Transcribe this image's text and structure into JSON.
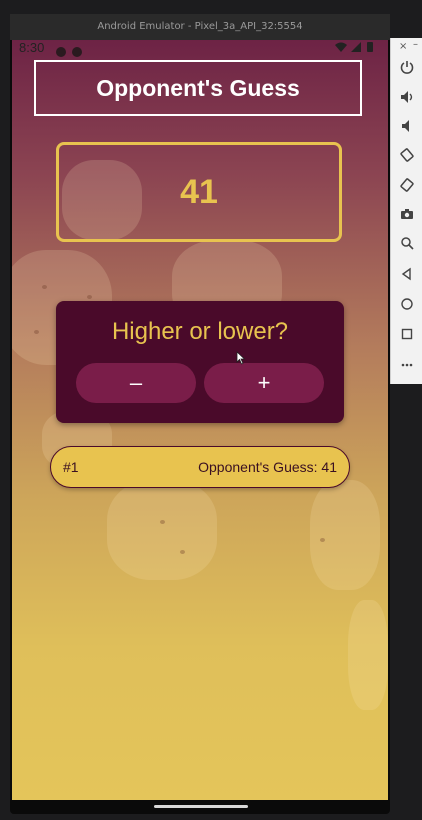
{
  "emulator": {
    "title": "Android Emulator - Pixel_3a_API_32:5554",
    "toolbar": {
      "close_label": "×",
      "minimize_label": "–",
      "icons": [
        "power-icon",
        "volume-up-icon",
        "volume-down-icon",
        "rotate-left-icon",
        "rotate-right-icon",
        "camera-icon",
        "zoom-icon",
        "back-icon",
        "home-icon",
        "overview-icon",
        "more-icon"
      ]
    }
  },
  "status_bar": {
    "time": "8:30"
  },
  "app": {
    "title": "Opponent's Guess",
    "current_guess": "41",
    "prompt": "Higher or lower?",
    "minus_label": "–",
    "plus_label": "+",
    "log": [
      {
        "round": "#1",
        "text": "Opponent's Guess: 41"
      }
    ]
  },
  "colors": {
    "accent": "#e8c34f",
    "primary_dark": "#4a0a2a",
    "button": "#7a1d49",
    "gradient_top": "#6d2345",
    "gradient_bottom": "#e4c55a"
  }
}
